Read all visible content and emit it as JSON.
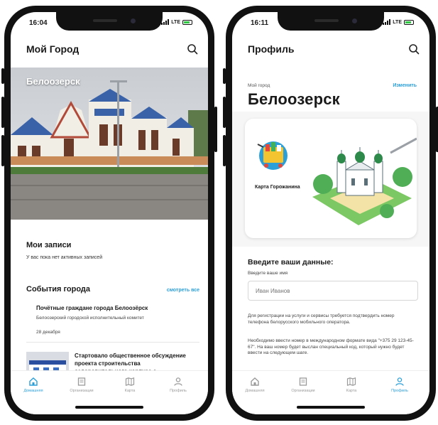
{
  "left_phone": {
    "status_time": "16:04",
    "status_network": "LTE",
    "app_title": "Мой Город",
    "hero_city": "Белоозерск",
    "my_records": {
      "title": "Мои записи",
      "empty_text": "У вас пока нет активных записей"
    },
    "city_events": {
      "title": "События города",
      "see_all": "смотреть все",
      "event": {
        "title": "Почётные граждане города Белоозёрск",
        "org": "Белоозерский городской исполнительный комитет",
        "date": "28 декабря"
      },
      "news": {
        "title": "Стартовало общественное обсуждение проекта строительства оздоровительного корпуса с"
      }
    },
    "tabs": [
      {
        "label": "Домашняя",
        "icon": "home-icon",
        "active": true
      },
      {
        "label": "Организации",
        "icon": "building-icon",
        "active": false
      },
      {
        "label": "Карта",
        "icon": "map-icon",
        "active": false
      },
      {
        "label": "Профиль",
        "icon": "person-icon",
        "active": false
      }
    ]
  },
  "right_phone": {
    "status_time": "16:11",
    "status_network": "LTE",
    "app_title": "Профиль",
    "my_city_label": "Мой город",
    "change_link": "Изменить",
    "city_name": "Белоозерск",
    "card_label": "Карта Горожанина",
    "form": {
      "title": "Введите ваши данные:",
      "name_label": "Введите ваше имя",
      "name_placeholder": "Иван Иванов",
      "paragraph_1": "Для регистрации на услуги и сервисы требуется подтвердить номер телефона белорусского мобильного оператора.",
      "paragraph_2": "Необходимо ввести номер в международном формате вида \"+375 29 123-45-67\". На ваш номер будет выслан специальный код, который нужно будет ввести на следующем шаге."
    },
    "tabs": [
      {
        "label": "Домашняя",
        "icon": "home-icon",
        "active": false
      },
      {
        "label": "Организации",
        "icon": "building-icon",
        "active": false
      },
      {
        "label": "Карта",
        "icon": "map-icon",
        "active": false
      },
      {
        "label": "Профиль",
        "icon": "person-icon",
        "active": true
      }
    ]
  },
  "colors": {
    "accent": "#2b9fd8",
    "phone_frame": "#111111",
    "inactive_tab": "#9a9a9a"
  }
}
